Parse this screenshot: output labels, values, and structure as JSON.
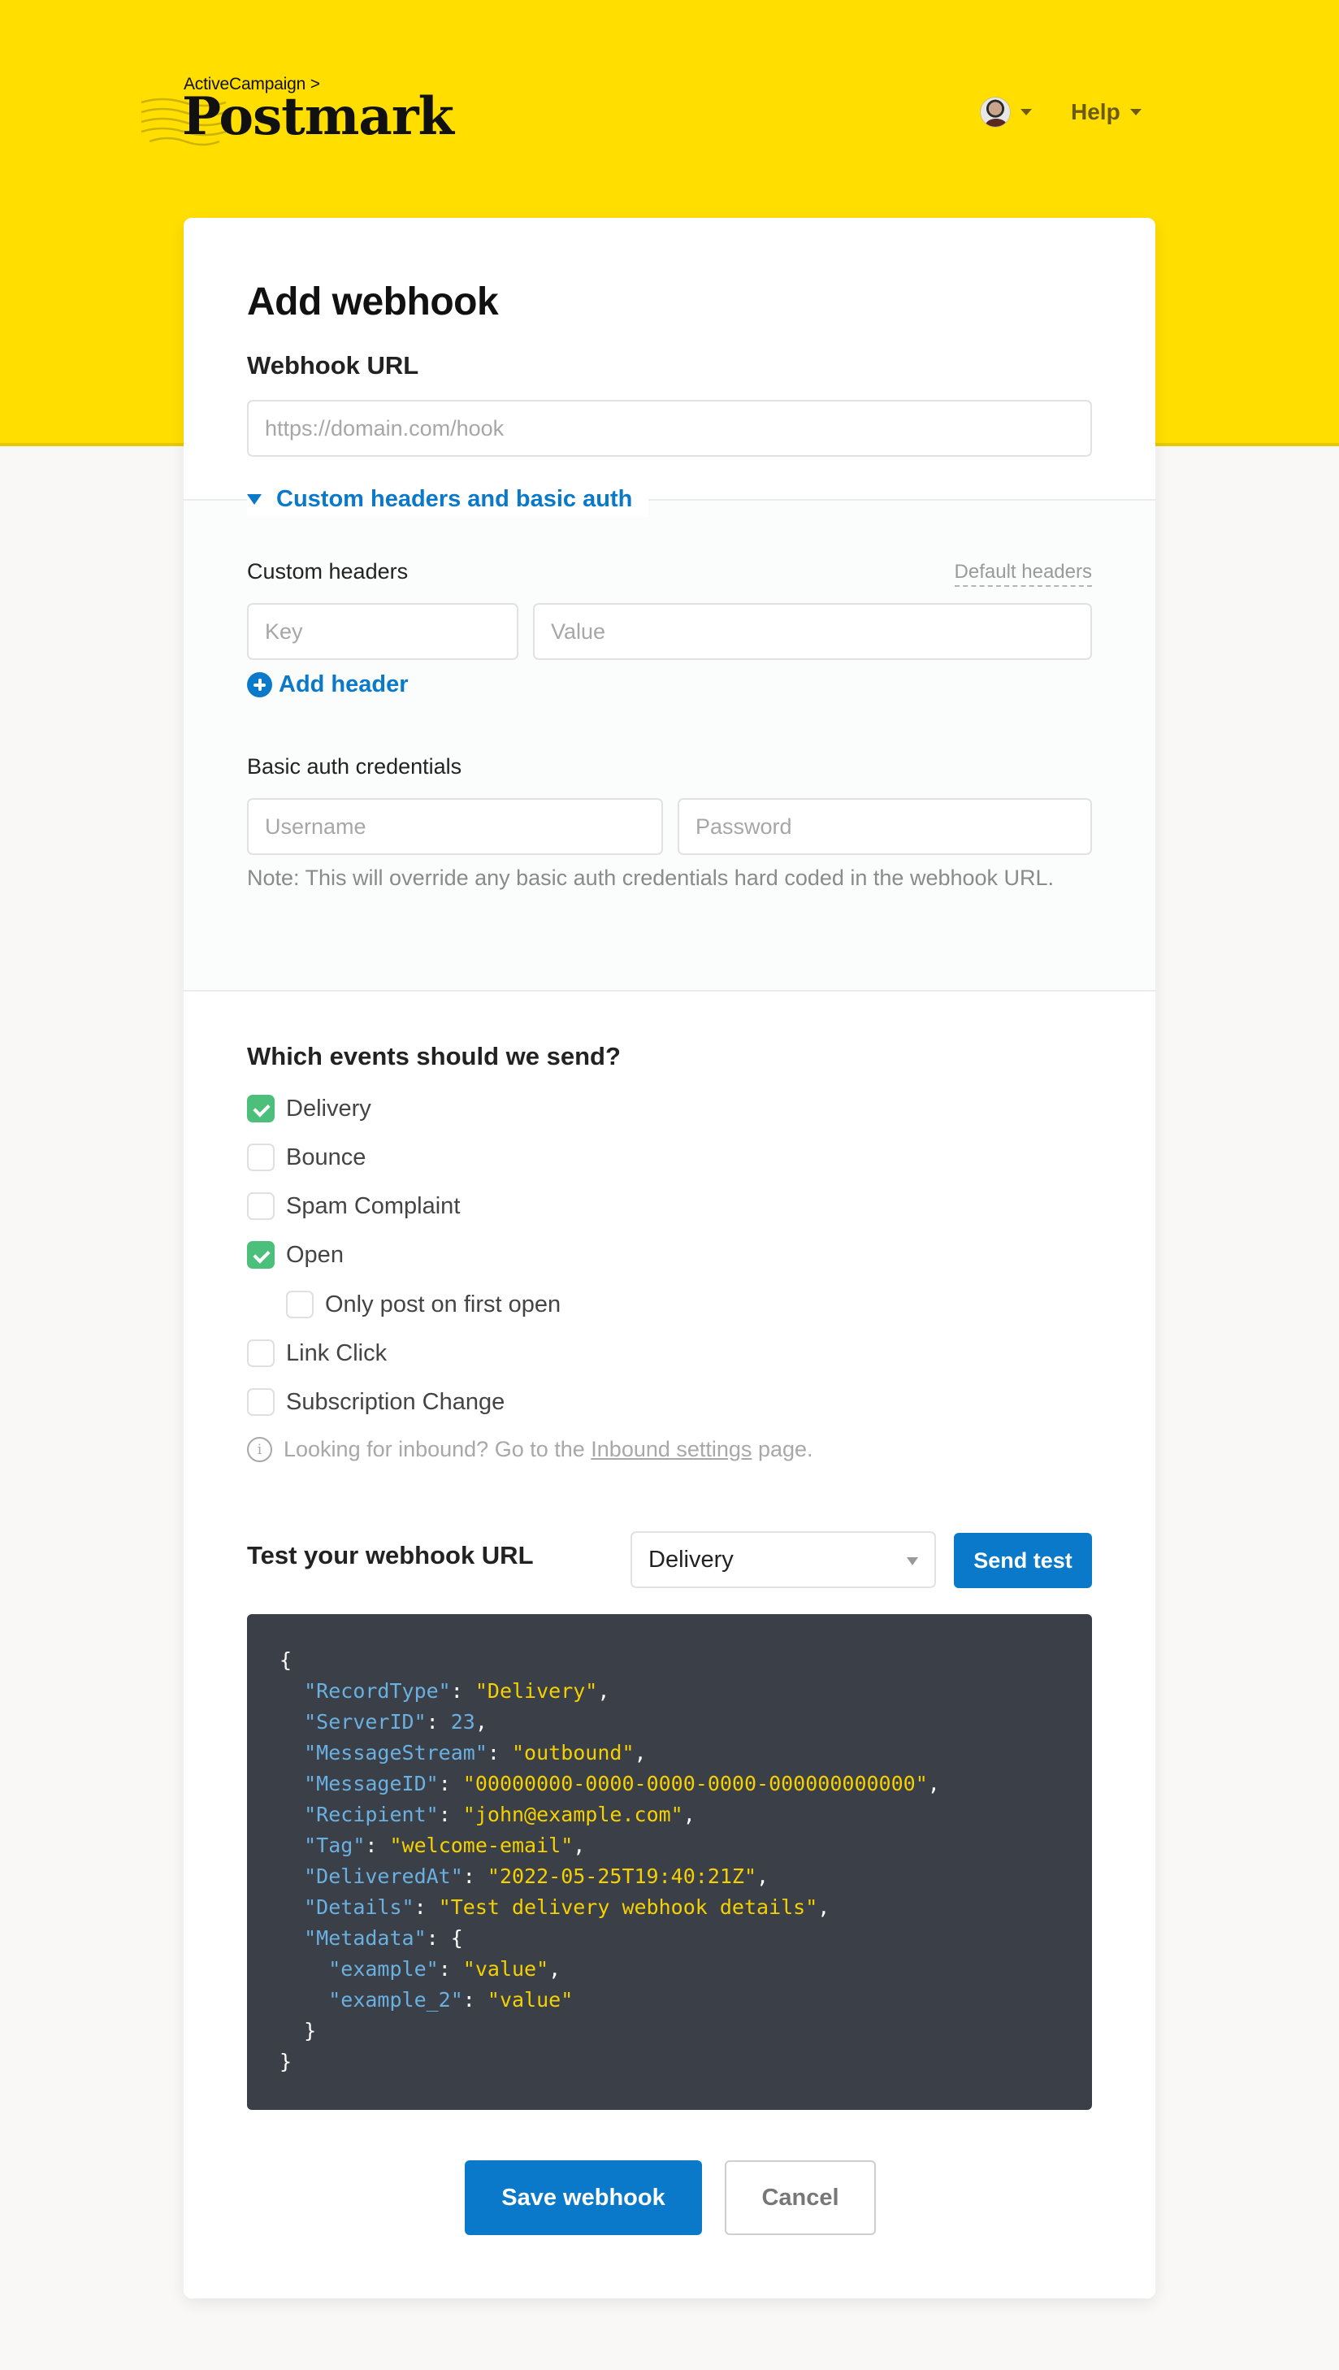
{
  "header": {
    "brand_parent": "ActiveCampaign >",
    "brand_name": "Postmark",
    "help_label": "Help",
    "accent_color": "#ffde00"
  },
  "form": {
    "title": "Add webhook",
    "url_label": "Webhook URL",
    "url_placeholder": "https://domain.com/hook",
    "url_value": "",
    "disclosure_label": "Custom headers and basic auth",
    "custom_headers_label": "Custom headers",
    "default_headers_link": "Default headers",
    "key_placeholder": "Key",
    "value_placeholder": "Value",
    "add_header_label": "Add header",
    "basic_auth_label": "Basic auth credentials",
    "username_placeholder": "Username",
    "password_placeholder": "Password",
    "note": "Note: This will override any basic auth credentials hard coded in the webhook URL.",
    "primary_color": "#0a79c9"
  },
  "events": {
    "title": "Which events should we send?",
    "items": [
      {
        "label": "Delivery",
        "checked": true
      },
      {
        "label": "Bounce",
        "checked": false
      },
      {
        "label": "Spam Complaint",
        "checked": false
      },
      {
        "label": "Open",
        "checked": true
      },
      {
        "label": "Only post on first open",
        "checked": false,
        "indented": true
      },
      {
        "label": "Link Click",
        "checked": false
      },
      {
        "label": "Subscription Change",
        "checked": false
      }
    ],
    "inbound_prefix": "Looking for inbound? Go to the ",
    "inbound_link": "Inbound settings",
    "inbound_suffix": " page.",
    "check_color": "#4cc07a"
  },
  "test": {
    "title": "Test your webhook URL",
    "selected_event": "Delivery",
    "send_label": "Send test",
    "payload": [
      {
        "indent": 0,
        "text": "{"
      },
      {
        "indent": 1,
        "key": "RecordType",
        "value": "\"Delivery\"",
        "type": "string",
        "comma": true
      },
      {
        "indent": 1,
        "key": "ServerID",
        "value": "23",
        "type": "number",
        "comma": true
      },
      {
        "indent": 1,
        "key": "MessageStream",
        "value": "\"outbound\"",
        "type": "string",
        "comma": true
      },
      {
        "indent": 1,
        "key": "MessageID",
        "value": "\"00000000-0000-0000-0000-000000000000\"",
        "type": "string",
        "comma": true
      },
      {
        "indent": 1,
        "key": "Recipient",
        "value": "\"john@example.com\"",
        "type": "string",
        "comma": true
      },
      {
        "indent": 1,
        "key": "Tag",
        "value": "\"welcome-email\"",
        "type": "string",
        "comma": true
      },
      {
        "indent": 1,
        "key": "DeliveredAt",
        "value": "\"2022-05-25T19:40:21Z\"",
        "type": "string",
        "comma": true
      },
      {
        "indent": 1,
        "key": "Details",
        "value": "\"Test delivery webhook details\"",
        "type": "string",
        "comma": true
      },
      {
        "indent": 1,
        "key": "Metadata",
        "value": "{",
        "type": "brace",
        "comma": false
      },
      {
        "indent": 2,
        "key": "example",
        "value": "\"value\"",
        "type": "string",
        "comma": true
      },
      {
        "indent": 2,
        "key": "example_2",
        "value": "\"value\"",
        "type": "string",
        "comma": false
      },
      {
        "indent": 1,
        "text": "}"
      },
      {
        "indent": 0,
        "text": "}"
      }
    ]
  },
  "actions": {
    "save_label": "Save webhook",
    "cancel_label": "Cancel"
  }
}
